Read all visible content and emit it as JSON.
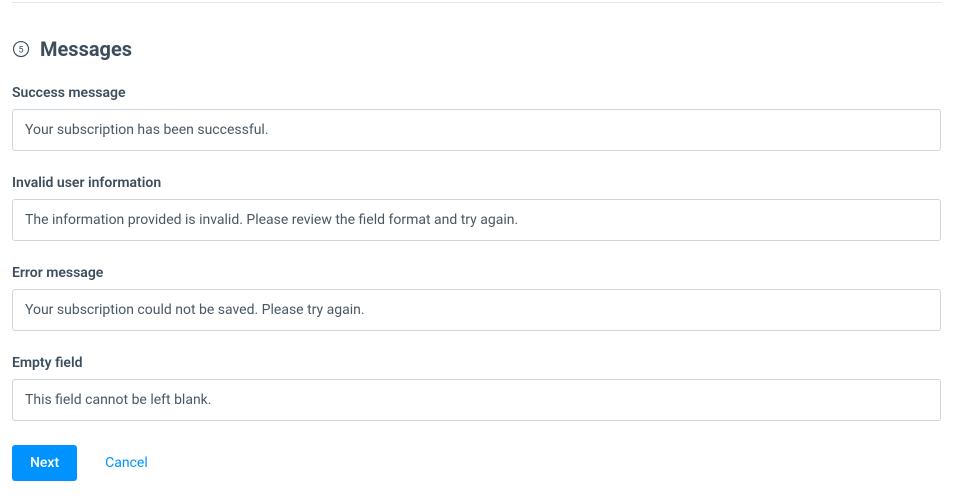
{
  "section": {
    "step_number": "5",
    "title": "Messages"
  },
  "fields": {
    "success": {
      "label": "Success message",
      "value": "Your subscription has been successful."
    },
    "invalid": {
      "label": "Invalid user information",
      "value": "The information provided is invalid. Please review the field format and try again."
    },
    "error": {
      "label": "Error message",
      "value": "Your subscription could not be saved. Please try again."
    },
    "empty": {
      "label": "Empty field",
      "value": "This field cannot be left blank."
    }
  },
  "actions": {
    "next_label": "Next",
    "cancel_label": "Cancel"
  }
}
